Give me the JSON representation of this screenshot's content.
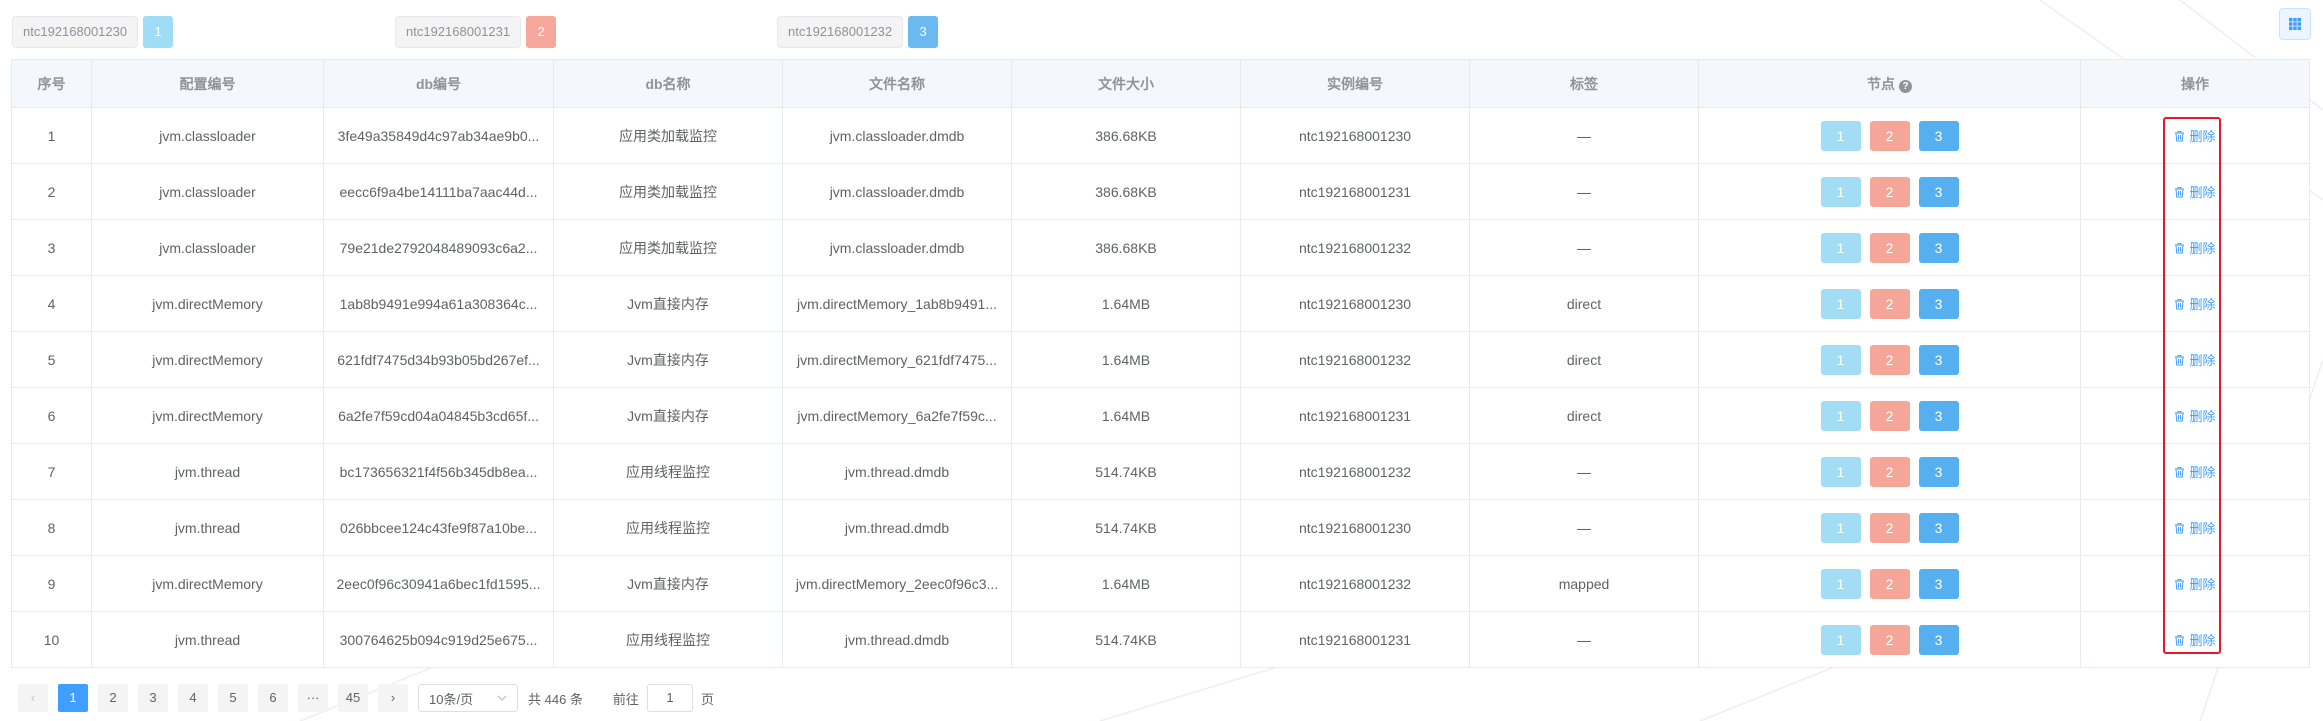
{
  "legend": [
    {
      "label": "ntc192168001230",
      "badge": "1",
      "color": "#9fdcf6"
    },
    {
      "label": "ntc192168001231",
      "badge": "2",
      "color": "#f4a79a"
    },
    {
      "label": "ntc192168001232",
      "badge": "3",
      "color": "#6ab9f1"
    }
  ],
  "toolbar": {
    "grid_icon": "grid-icon"
  },
  "table": {
    "headers": {
      "index": "序号",
      "config_id": "配置编号",
      "db_id": "db编号",
      "db_name": "db名称",
      "file_name": "文件名称",
      "file_size": "文件大小",
      "instance_id": "实例编号",
      "tag": "标签",
      "nodes": "节点",
      "actions": "操作"
    },
    "node_labels": [
      "1",
      "2",
      "3"
    ],
    "delete_label": "删除",
    "rows": [
      {
        "index": "1",
        "config_id": "jvm.classloader",
        "db_id": "3fe49a35849d4c97ab34ae9b0...",
        "db_name": "应用类加载监控",
        "file_name": "jvm.classloader.dmdb",
        "file_size": "386.68KB",
        "instance_id": "ntc192168001230",
        "tag": "—"
      },
      {
        "index": "2",
        "config_id": "jvm.classloader",
        "db_id": "eecc6f9a4be14111ba7aac44d...",
        "db_name": "应用类加载监控",
        "file_name": "jvm.classloader.dmdb",
        "file_size": "386.68KB",
        "instance_id": "ntc192168001231",
        "tag": "—"
      },
      {
        "index": "3",
        "config_id": "jvm.classloader",
        "db_id": "79e21de2792048489093c6a2...",
        "db_name": "应用类加载监控",
        "file_name": "jvm.classloader.dmdb",
        "file_size": "386.68KB",
        "instance_id": "ntc192168001232",
        "tag": "—"
      },
      {
        "index": "4",
        "config_id": "jvm.directMemory",
        "db_id": "1ab8b9491e994a61a308364c...",
        "db_name": "Jvm直接内存",
        "file_name": "jvm.directMemory_1ab8b9491...",
        "file_size": "1.64MB",
        "instance_id": "ntc192168001230",
        "tag": "direct"
      },
      {
        "index": "5",
        "config_id": "jvm.directMemory",
        "db_id": "621fdf7475d34b93b05bd267ef...",
        "db_name": "Jvm直接内存",
        "file_name": "jvm.directMemory_621fdf7475...",
        "file_size": "1.64MB",
        "instance_id": "ntc192168001232",
        "tag": "direct"
      },
      {
        "index": "6",
        "config_id": "jvm.directMemory",
        "db_id": "6a2fe7f59cd04a04845b3cd65f...",
        "db_name": "Jvm直接内存",
        "file_name": "jvm.directMemory_6a2fe7f59c...",
        "file_size": "1.64MB",
        "instance_id": "ntc192168001231",
        "tag": "direct"
      },
      {
        "index": "7",
        "config_id": "jvm.thread",
        "db_id": "bc173656321f4f56b345db8ea...",
        "db_name": "应用线程监控",
        "file_name": "jvm.thread.dmdb",
        "file_size": "514.74KB",
        "instance_id": "ntc192168001232",
        "tag": "—"
      },
      {
        "index": "8",
        "config_id": "jvm.thread",
        "db_id": "026bbcee124c43fe9f87a10be...",
        "db_name": "应用线程监控",
        "file_name": "jvm.thread.dmdb",
        "file_size": "514.74KB",
        "instance_id": "ntc192168001230",
        "tag": "—"
      },
      {
        "index": "9",
        "config_id": "jvm.directMemory",
        "db_id": "2eec0f96c30941a6bec1fd1595...",
        "db_name": "Jvm直接内存",
        "file_name": "jvm.directMemory_2eec0f96c3...",
        "file_size": "1.64MB",
        "instance_id": "ntc192168001232",
        "tag": "mapped"
      },
      {
        "index": "10",
        "config_id": "jvm.thread",
        "db_id": "300764625b094c919d25e675...",
        "db_name": "应用线程监控",
        "file_name": "jvm.thread.dmdb",
        "file_size": "514.74KB",
        "instance_id": "ntc192168001231",
        "tag": "—"
      }
    ]
  },
  "pagination": {
    "prev": "‹",
    "pages": [
      "1",
      "2",
      "3",
      "4",
      "5",
      "6"
    ],
    "ellipsis": "···",
    "last_page": "45",
    "next": "›",
    "current": "1",
    "page_size": "10条/页",
    "total": "共 446 条",
    "goto_prefix": "前往",
    "goto_value": "1",
    "goto_suffix": "页"
  },
  "colors": {
    "primary": "#409eff",
    "highlight": "#e8182a"
  }
}
